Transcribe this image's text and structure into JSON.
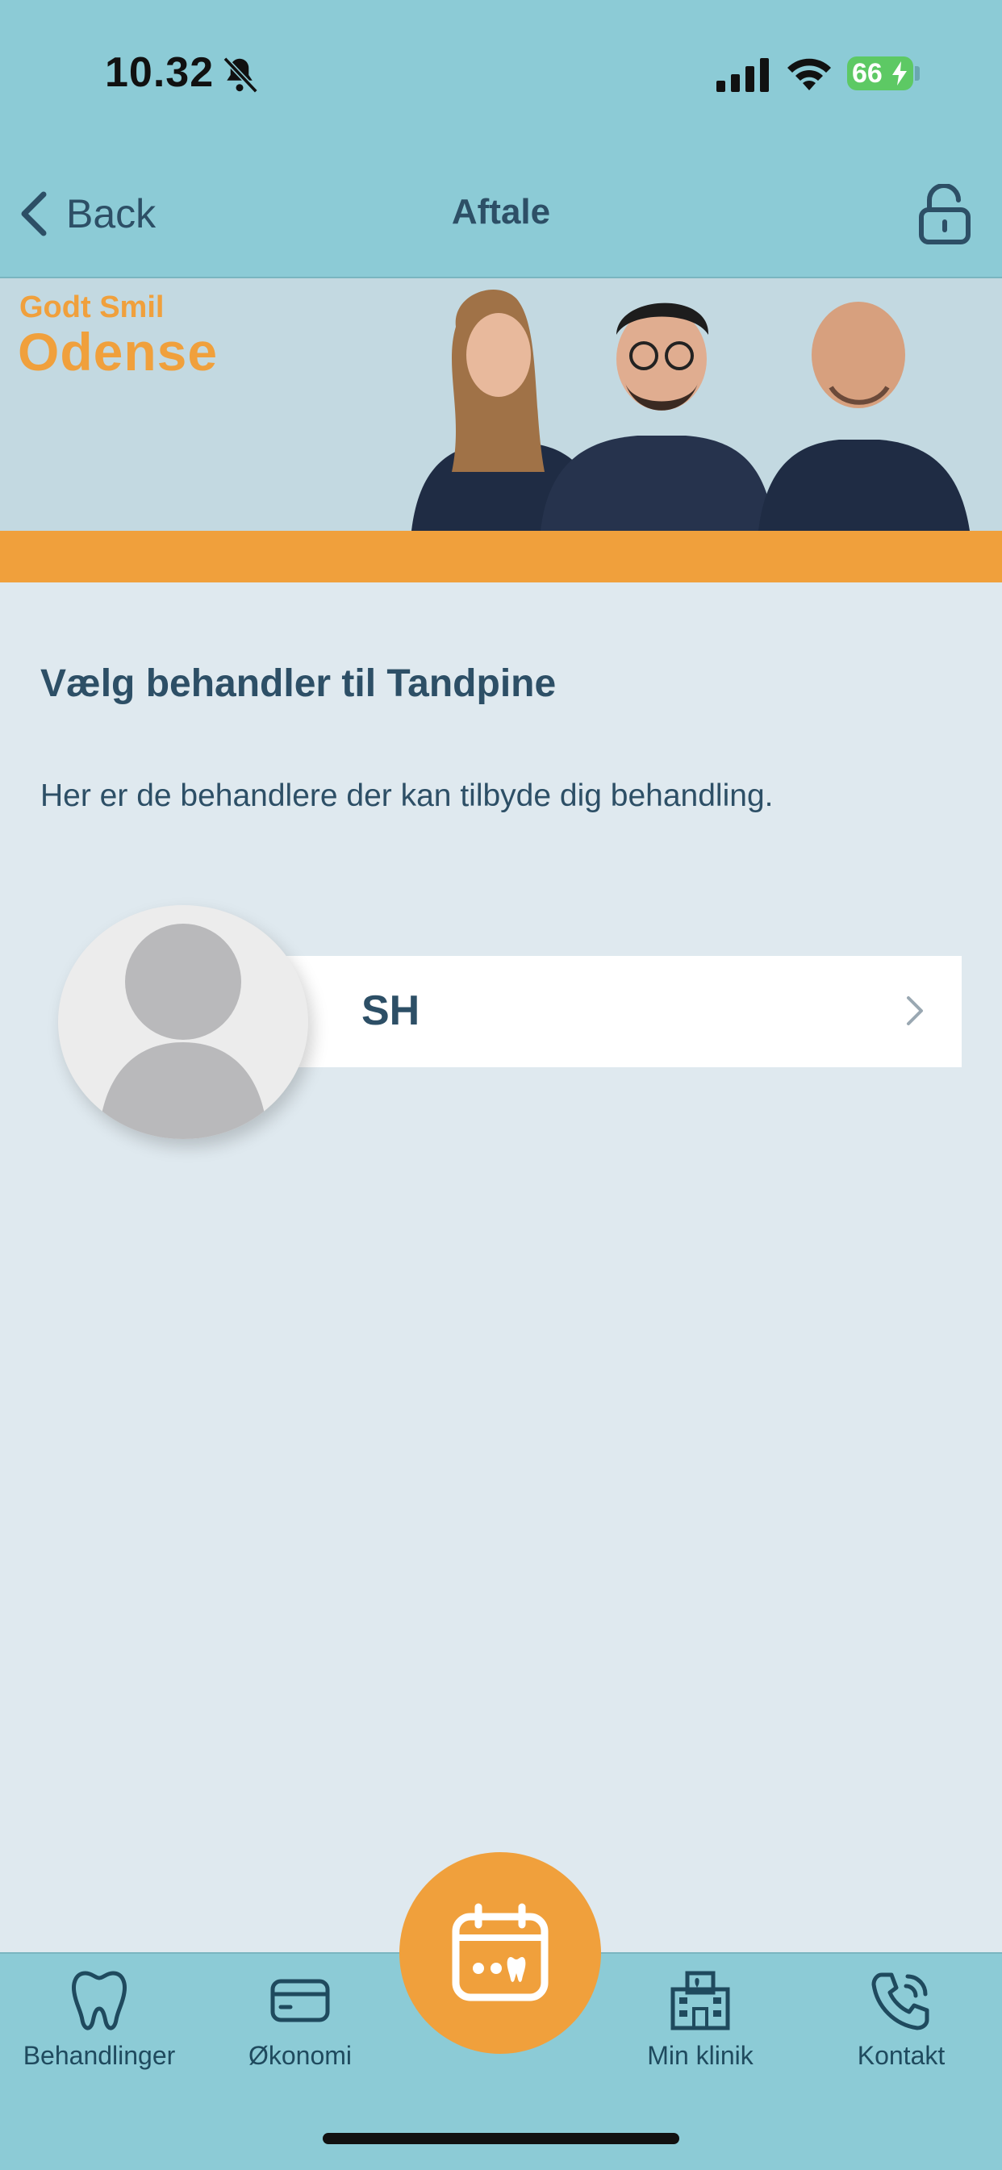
{
  "status_bar": {
    "time": "10.32",
    "battery": "66",
    "icons": [
      "bell-slash-icon",
      "signal-icon",
      "wifi-icon",
      "battery-charging-icon"
    ]
  },
  "nav": {
    "back_label": "Back",
    "title": "Aftale",
    "right_icon": "unlock-icon"
  },
  "banner": {
    "brand_line1": "Godt Smil",
    "brand_line2": "Odense",
    "accent_color": "#f0a03c"
  },
  "main": {
    "title": "Vælg behandler til Tandpine",
    "description": "Her er de behandlere der kan tilbyde dig behandling.",
    "providers": [
      {
        "name": "SH",
        "avatar": "default-person-icon"
      }
    ]
  },
  "tabbar": {
    "items": [
      {
        "label": "Behandlinger",
        "icon": "tooth-icon"
      },
      {
        "label": "Økonomi",
        "icon": "card-icon"
      },
      {
        "label": "",
        "icon": "calendar-tooth-icon"
      },
      {
        "label": "Min klinik",
        "icon": "clinic-building-icon"
      },
      {
        "label": "Kontakt",
        "icon": "phone-icon"
      }
    ]
  },
  "colors": {
    "header_bg": "#8ccbd6",
    "page_bg": "#dfe9ef",
    "text": "#2d4f66",
    "accent": "#f0a03c"
  }
}
